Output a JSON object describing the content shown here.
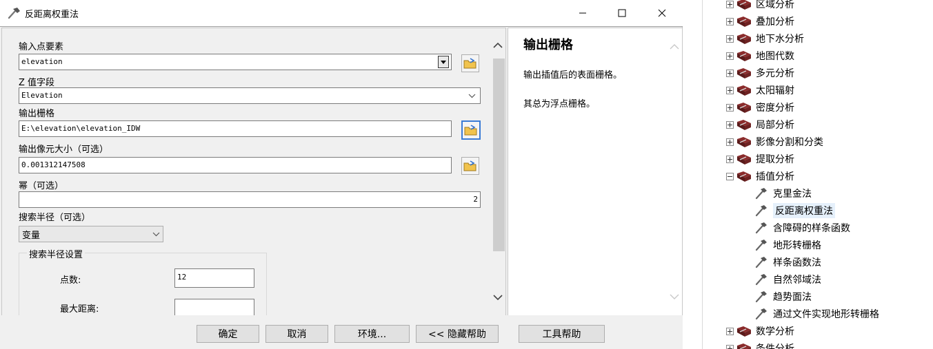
{
  "dialog": {
    "title": "反距离权重法",
    "fields": {
      "input_point": {
        "label": "输入点要素",
        "value": "elevation"
      },
      "z_field": {
        "label": "Z 值字段",
        "value": "Elevation"
      },
      "output_raster": {
        "label": "输出栅格",
        "value": "E:\\elevation\\elevation_IDW"
      },
      "cell_size": {
        "label": "输出像元大小（可选）",
        "value": "0.001312147508"
      },
      "power": {
        "label": "幂（可选）",
        "value": "2"
      },
      "search_radius": {
        "label": "搜索半径（可选）",
        "value": "变量"
      }
    },
    "search_settings": {
      "title": "搜索半径设置",
      "points_label": "点数:",
      "points_value": "12",
      "max_distance_label": "最大距离:",
      "max_distance_value": ""
    },
    "help": {
      "title": "输出栅格",
      "p1": "输出插值后的表面栅格。",
      "p2": "其总为浮点栅格。"
    },
    "buttons": {
      "ok": "确定",
      "cancel": "取消",
      "env": "环境...",
      "hide_help": "<< 隐藏帮助",
      "tool_help": "工具帮助"
    }
  },
  "tree": {
    "toolsets": [
      {
        "label": "区域分析",
        "expanded": false
      },
      {
        "label": "叠加分析",
        "expanded": false
      },
      {
        "label": "地下水分析",
        "expanded": false
      },
      {
        "label": "地图代数",
        "expanded": false
      },
      {
        "label": "多元分析",
        "expanded": false
      },
      {
        "label": "太阳辐射",
        "expanded": false
      },
      {
        "label": "密度分析",
        "expanded": false
      },
      {
        "label": "局部分析",
        "expanded": false
      },
      {
        "label": "影像分割和分类",
        "expanded": false
      },
      {
        "label": "提取分析",
        "expanded": false
      },
      {
        "label": "插值分析",
        "expanded": true
      }
    ],
    "tools": [
      {
        "label": "克里金法",
        "selected": false
      },
      {
        "label": "反距离权重法",
        "selected": true
      },
      {
        "label": "含障碍的样条函数",
        "selected": false
      },
      {
        "label": "地形转栅格",
        "selected": false
      },
      {
        "label": "样条函数法",
        "selected": false
      },
      {
        "label": "自然邻域法",
        "selected": false
      },
      {
        "label": "趋势面法",
        "selected": false
      },
      {
        "label": "通过文件实现地形转栅格",
        "selected": false
      }
    ],
    "after": [
      {
        "label": "数学分析",
        "expanded": false
      },
      {
        "label": "条件分析",
        "expanded": false
      }
    ]
  },
  "colors": {
    "accent": "#3a7bd5",
    "toolset_icon": "#8b2b2b",
    "selected_bg": "#e5f0fb"
  }
}
